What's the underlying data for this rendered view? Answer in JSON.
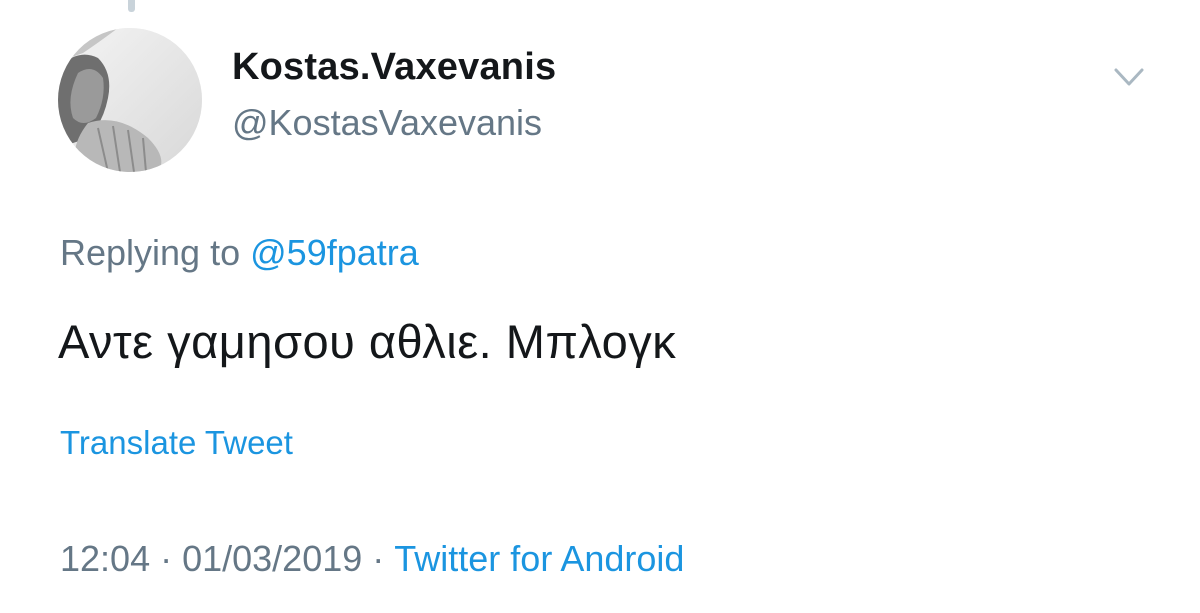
{
  "author": {
    "display_name": "Kostas.Vaxevanis",
    "handle": "@KostasVaxevanis"
  },
  "reply": {
    "prefix": "Replying to",
    "mention": "@59fpatra"
  },
  "tweet": {
    "text": "Αντε γαμησου αθλιε. Μπλογκ"
  },
  "translate_label": "Translate Tweet",
  "meta": {
    "time": "12:04",
    "date": "01/03/2019",
    "separator": "·",
    "source": "Twitter for Android"
  },
  "icons": {
    "menu": "chevron-down-icon",
    "avatar": "avatar"
  },
  "colors": {
    "primary_text": "#14171a",
    "secondary_text": "#657786",
    "link": "#1b95e0"
  }
}
